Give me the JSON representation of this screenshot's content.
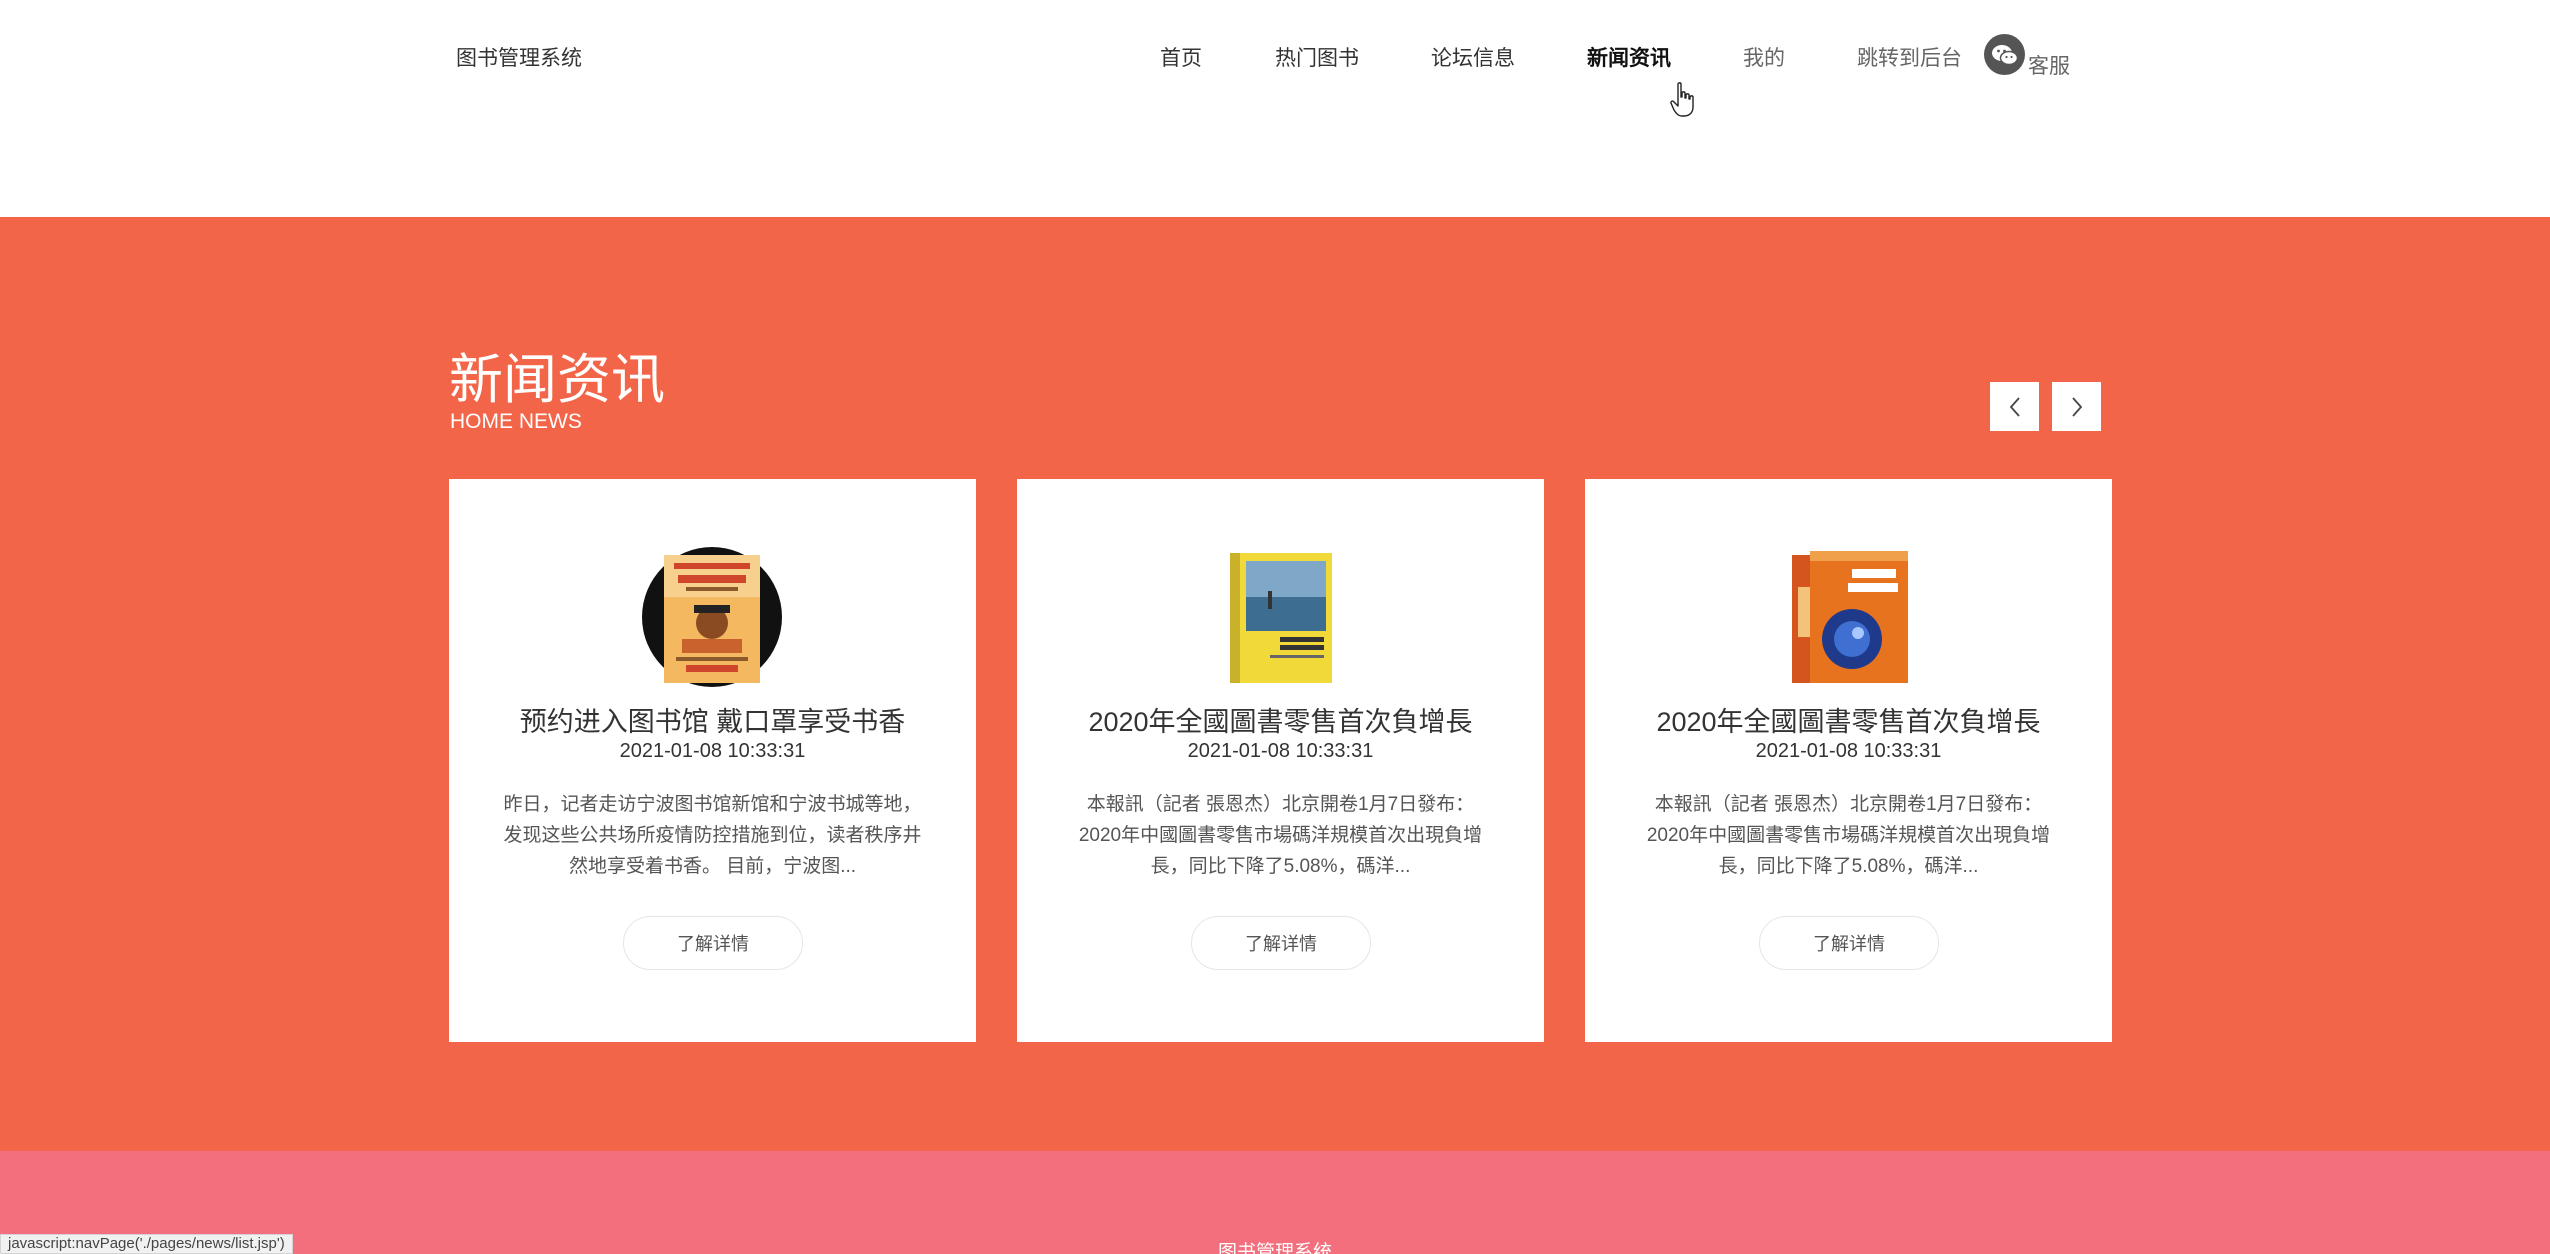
{
  "header": {
    "brand": "图书管理系统",
    "nav": [
      "首页",
      "热门图书",
      "论坛信息",
      "新闻资讯",
      "我的",
      "跳转到后台"
    ],
    "service_label": "客服"
  },
  "news": {
    "title": "新闻资讯",
    "subtitle": "HOME NEWS",
    "cards": [
      {
        "title": "预约进入图书馆 戴口罩享受书香",
        "date": "2021-01-08 10:33:31",
        "excerpt": "昨日，记者走访宁波图书馆新馆和宁波书城等地，发现这些公共场所疫情防控措施到位，读者秩序井然地享受着书香。 目前，宁波图...",
        "button": "了解详情"
      },
      {
        "title": "2020年全國圖書零售首次負增長",
        "date": "2021-01-08 10:33:31",
        "excerpt": "本報訊（記者 張恩杰）北京開卷1月7日發布：2020年中國圖書零售市場碼洋規模首次出現負增長，同比下降了5.08%，碼洋...",
        "button": "了解详情"
      },
      {
        "title": "2020年全國圖書零售首次負增長",
        "date": "2021-01-08 10:33:31",
        "excerpt": "本報訊（記者 張恩杰）北京開卷1月7日發布：2020年中國圖書零售市場碼洋規模首次出現負增長，同比下降了5.08%，碼洋...",
        "button": "了解详情"
      }
    ]
  },
  "footer": {
    "brand": "图书管理系统"
  },
  "status_bar": "javascript:navPage('./pages/news/list.jsp')",
  "colors": {
    "news_bg": "#f26549",
    "footer_bg": "#f36f7d"
  },
  "icons": [
    "wechat-icon",
    "chevron-left-icon",
    "chevron-right-icon",
    "hand-pointer-icon"
  ]
}
